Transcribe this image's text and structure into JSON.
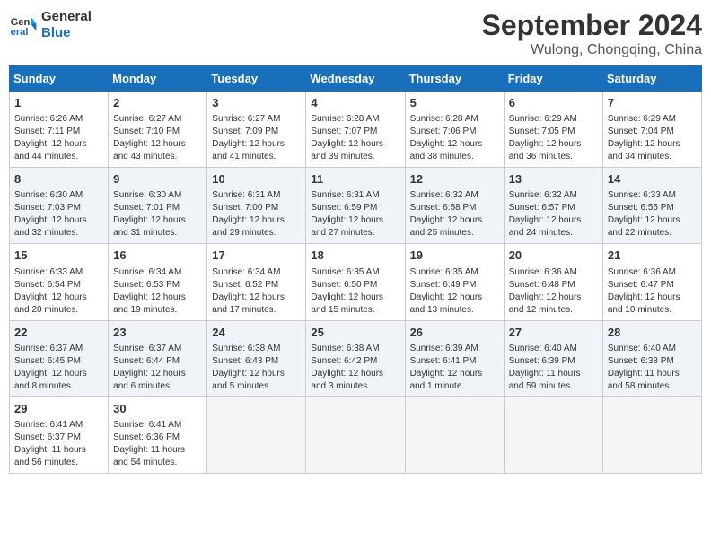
{
  "logo": {
    "text_general": "General",
    "text_blue": "Blue"
  },
  "header": {
    "month": "September 2024",
    "location": "Wulong, Chongqing, China"
  },
  "weekdays": [
    "Sunday",
    "Monday",
    "Tuesday",
    "Wednesday",
    "Thursday",
    "Friday",
    "Saturday"
  ],
  "weeks": [
    [
      {
        "day": "1",
        "info": "Sunrise: 6:26 AM\nSunset: 7:11 PM\nDaylight: 12 hours\nand 44 minutes."
      },
      {
        "day": "2",
        "info": "Sunrise: 6:27 AM\nSunset: 7:10 PM\nDaylight: 12 hours\nand 43 minutes."
      },
      {
        "day": "3",
        "info": "Sunrise: 6:27 AM\nSunset: 7:09 PM\nDaylight: 12 hours\nand 41 minutes."
      },
      {
        "day": "4",
        "info": "Sunrise: 6:28 AM\nSunset: 7:07 PM\nDaylight: 12 hours\nand 39 minutes."
      },
      {
        "day": "5",
        "info": "Sunrise: 6:28 AM\nSunset: 7:06 PM\nDaylight: 12 hours\nand 38 minutes."
      },
      {
        "day": "6",
        "info": "Sunrise: 6:29 AM\nSunset: 7:05 PM\nDaylight: 12 hours\nand 36 minutes."
      },
      {
        "day": "7",
        "info": "Sunrise: 6:29 AM\nSunset: 7:04 PM\nDaylight: 12 hours\nand 34 minutes."
      }
    ],
    [
      {
        "day": "8",
        "info": "Sunrise: 6:30 AM\nSunset: 7:03 PM\nDaylight: 12 hours\nand 32 minutes."
      },
      {
        "day": "9",
        "info": "Sunrise: 6:30 AM\nSunset: 7:01 PM\nDaylight: 12 hours\nand 31 minutes."
      },
      {
        "day": "10",
        "info": "Sunrise: 6:31 AM\nSunset: 7:00 PM\nDaylight: 12 hours\nand 29 minutes."
      },
      {
        "day": "11",
        "info": "Sunrise: 6:31 AM\nSunset: 6:59 PM\nDaylight: 12 hours\nand 27 minutes."
      },
      {
        "day": "12",
        "info": "Sunrise: 6:32 AM\nSunset: 6:58 PM\nDaylight: 12 hours\nand 25 minutes."
      },
      {
        "day": "13",
        "info": "Sunrise: 6:32 AM\nSunset: 6:57 PM\nDaylight: 12 hours\nand 24 minutes."
      },
      {
        "day": "14",
        "info": "Sunrise: 6:33 AM\nSunset: 6:55 PM\nDaylight: 12 hours\nand 22 minutes."
      }
    ],
    [
      {
        "day": "15",
        "info": "Sunrise: 6:33 AM\nSunset: 6:54 PM\nDaylight: 12 hours\nand 20 minutes."
      },
      {
        "day": "16",
        "info": "Sunrise: 6:34 AM\nSunset: 6:53 PM\nDaylight: 12 hours\nand 19 minutes."
      },
      {
        "day": "17",
        "info": "Sunrise: 6:34 AM\nSunset: 6:52 PM\nDaylight: 12 hours\nand 17 minutes."
      },
      {
        "day": "18",
        "info": "Sunrise: 6:35 AM\nSunset: 6:50 PM\nDaylight: 12 hours\nand 15 minutes."
      },
      {
        "day": "19",
        "info": "Sunrise: 6:35 AM\nSunset: 6:49 PM\nDaylight: 12 hours\nand 13 minutes."
      },
      {
        "day": "20",
        "info": "Sunrise: 6:36 AM\nSunset: 6:48 PM\nDaylight: 12 hours\nand 12 minutes."
      },
      {
        "day": "21",
        "info": "Sunrise: 6:36 AM\nSunset: 6:47 PM\nDaylight: 12 hours\nand 10 minutes."
      }
    ],
    [
      {
        "day": "22",
        "info": "Sunrise: 6:37 AM\nSunset: 6:45 PM\nDaylight: 12 hours\nand 8 minutes."
      },
      {
        "day": "23",
        "info": "Sunrise: 6:37 AM\nSunset: 6:44 PM\nDaylight: 12 hours\nand 6 minutes."
      },
      {
        "day": "24",
        "info": "Sunrise: 6:38 AM\nSunset: 6:43 PM\nDaylight: 12 hours\nand 5 minutes."
      },
      {
        "day": "25",
        "info": "Sunrise: 6:38 AM\nSunset: 6:42 PM\nDaylight: 12 hours\nand 3 minutes."
      },
      {
        "day": "26",
        "info": "Sunrise: 6:39 AM\nSunset: 6:41 PM\nDaylight: 12 hours\nand 1 minute."
      },
      {
        "day": "27",
        "info": "Sunrise: 6:40 AM\nSunset: 6:39 PM\nDaylight: 11 hours\nand 59 minutes."
      },
      {
        "day": "28",
        "info": "Sunrise: 6:40 AM\nSunset: 6:38 PM\nDaylight: 11 hours\nand 58 minutes."
      }
    ],
    [
      {
        "day": "29",
        "info": "Sunrise: 6:41 AM\nSunset: 6:37 PM\nDaylight: 11 hours\nand 56 minutes."
      },
      {
        "day": "30",
        "info": "Sunrise: 6:41 AM\nSunset: 6:36 PM\nDaylight: 11 hours\nand 54 minutes."
      },
      {
        "day": "",
        "info": ""
      },
      {
        "day": "",
        "info": ""
      },
      {
        "day": "",
        "info": ""
      },
      {
        "day": "",
        "info": ""
      },
      {
        "day": "",
        "info": ""
      }
    ]
  ]
}
